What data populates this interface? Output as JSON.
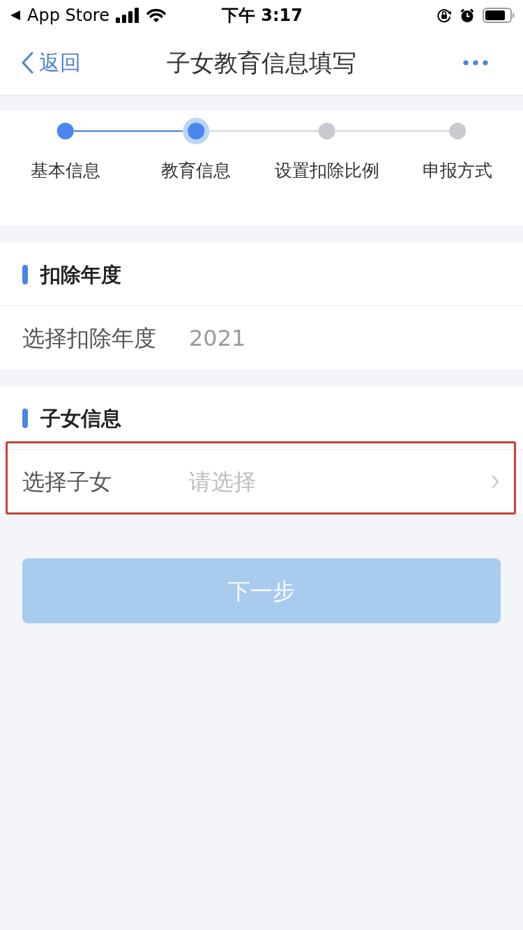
{
  "status_bar": {
    "back_app": "App Store",
    "time": "下午 3:17"
  },
  "nav_bar": {
    "back_label": "返回",
    "title": "子女教育信息填写"
  },
  "steps": [
    {
      "label": "基本信息",
      "completed": true,
      "selected": false
    },
    {
      "label": "教育信息",
      "completed": false,
      "selected": true
    },
    {
      "label": "设置扣除比例",
      "completed": false,
      "selected": false
    },
    {
      "label": "申报方式",
      "completed": false,
      "selected": false
    }
  ],
  "sections": [
    {
      "title": "扣除年度",
      "rows": [
        {
          "label": "选择扣除年度",
          "value": "2021",
          "chevron": false,
          "highlighted": false
        }
      ]
    },
    {
      "title": "子女信息",
      "rows": [
        {
          "label": "选择子女",
          "placeholder": "请选择",
          "chevron": true,
          "highlighted": true
        }
      ]
    }
  ],
  "next_button": {
    "label": "下一步",
    "disabled": true
  }
}
